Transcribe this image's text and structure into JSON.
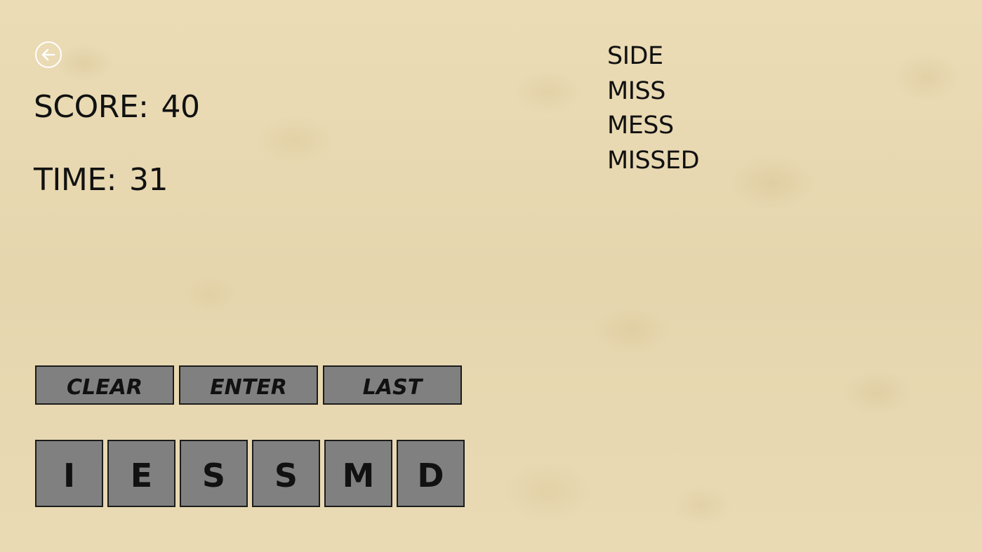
{
  "header": {
    "back_icon": "arrow-left-circle-icon",
    "score_label": "SCORE:",
    "score_value": "40",
    "time_label": "TIME:",
    "time_value": "31"
  },
  "found_words": [
    "SIDE",
    "MISS",
    "MESS",
    "MISSED"
  ],
  "actions": {
    "clear_label": "CLEAR",
    "enter_label": "ENTER",
    "last_label": "LAST"
  },
  "tiles": [
    "I",
    "E",
    "S",
    "S",
    "M",
    "D"
  ],
  "colors": {
    "background": "#e8d9b2",
    "button_fill": "#808080",
    "button_border": "#1c1c1c",
    "text": "#111111",
    "back_icon": "#ffffff"
  }
}
